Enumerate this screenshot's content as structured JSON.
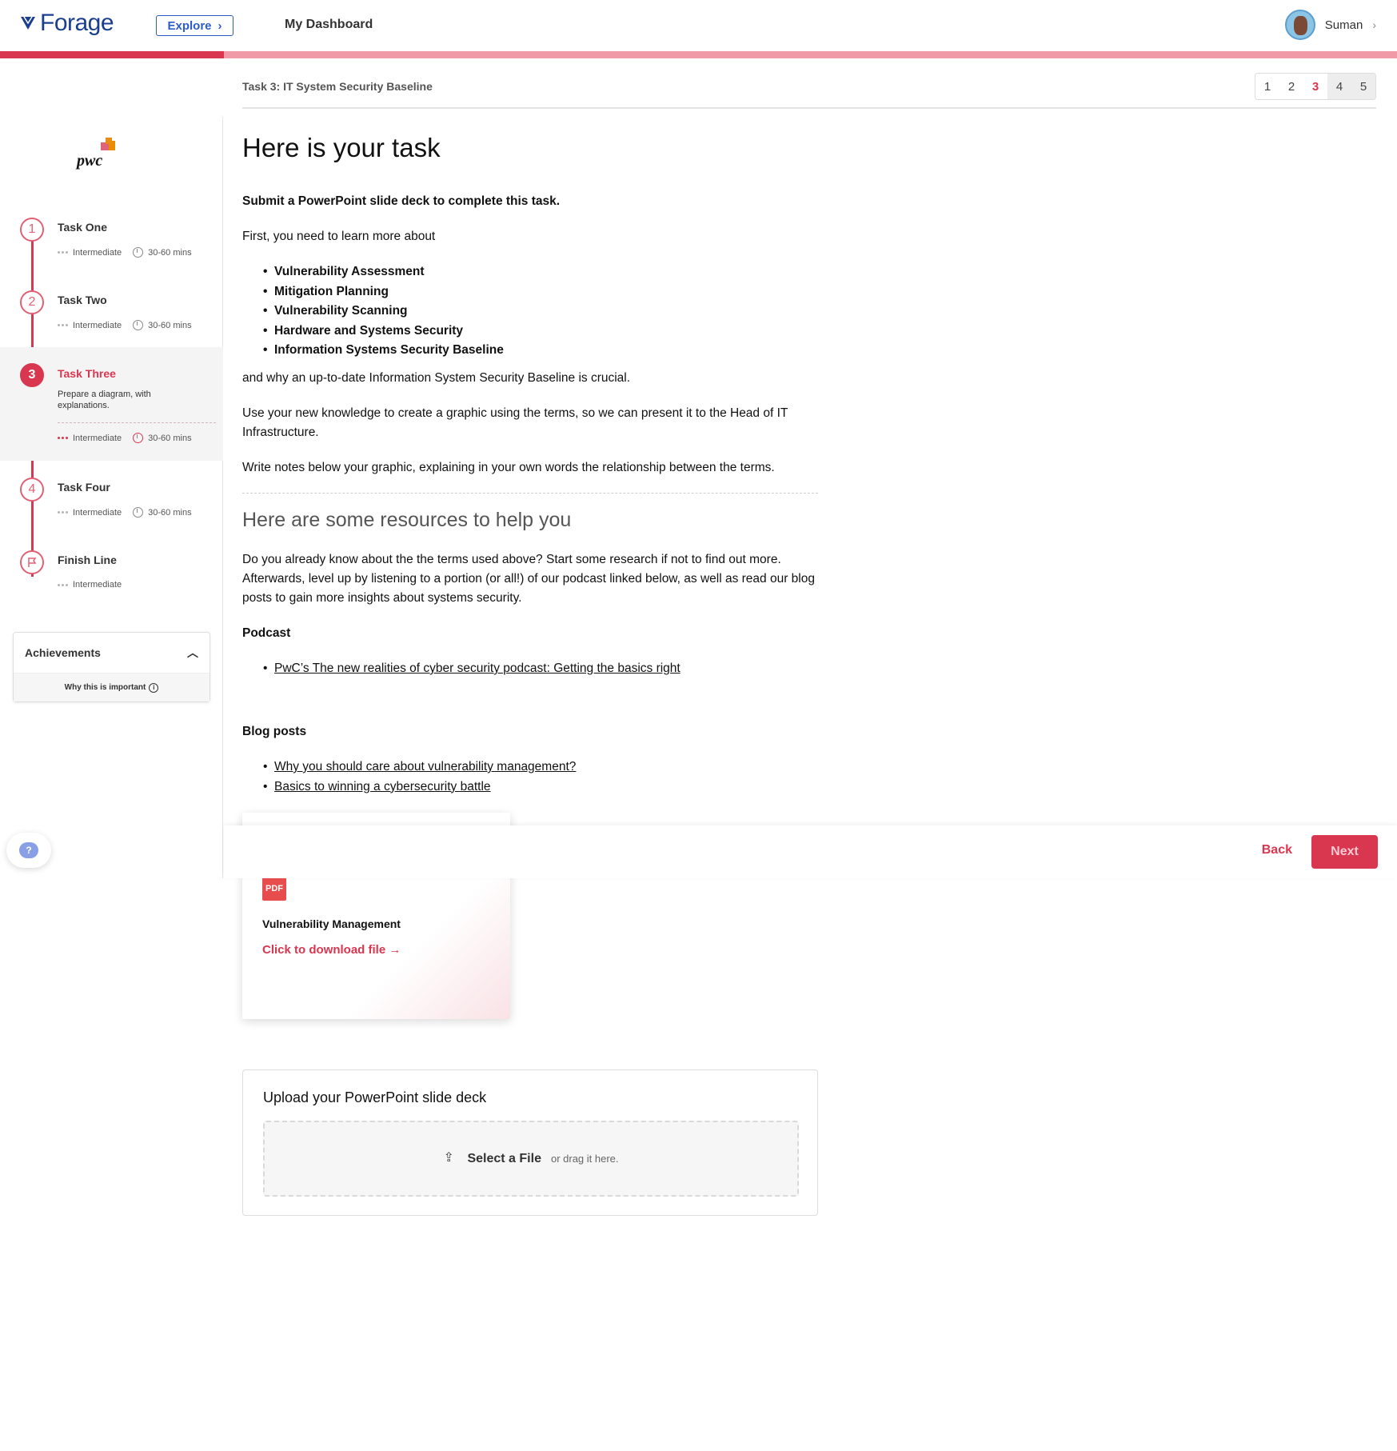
{
  "header": {
    "brand": "Forage",
    "explore_label": "Explore",
    "dashboard_label": "My Dashboard",
    "user_name": "Suman",
    "progress_fraction": 0.16
  },
  "task_header": {
    "label": "Task 3: IT System Security Baseline",
    "pages": [
      "1",
      "2",
      "3",
      "4",
      "5"
    ],
    "current_page": "3"
  },
  "sidebar": {
    "company": "pwc",
    "steps": [
      {
        "number": "1",
        "title": "Task One",
        "level": "Intermediate",
        "duration": "30-60 mins"
      },
      {
        "number": "2",
        "title": "Task Two",
        "level": "Intermediate",
        "duration": "30-60 mins"
      },
      {
        "number": "3",
        "title": "Task Three",
        "description": "Prepare a diagram, with explanations.",
        "level": "Intermediate",
        "duration": "30-60 mins"
      },
      {
        "number": "4",
        "title": "Task Four",
        "level": "Intermediate",
        "duration": "30-60 mins"
      },
      {
        "title": "Finish Line",
        "level": "Intermediate"
      }
    ],
    "achievements": {
      "title": "Achievements",
      "footer": "Why this is important"
    }
  },
  "content": {
    "heading": "Here is your task",
    "intro_bold": "Submit a PowerPoint slide deck to complete this task.",
    "learn_intro": "First, you need to learn more about",
    "topics": [
      "Vulnerability Assessment",
      "Mitigation Planning",
      "Vulnerability Scanning",
      "Hardware and Systems Security",
      "Information Systems Security Baseline"
    ],
    "why": "and why an up-to-date Information System Security Baseline is crucial.",
    "instruction": "Use your new knowledge to create a graphic using the terms, so we can present it to the Head of IT Infrastructure.",
    "notes": "Write notes below your graphic, explaining in your own words the relationship between the terms.",
    "resources_heading": "Here are some resources to help you",
    "resources_intro": "Do you already know about the the terms used above? Start some research if not to find out more. Afterwards, level up by listening to a portion (or all!) of our podcast linked below, as well as read our blog posts to gain more insights about systems security.",
    "podcast_heading": "Podcast",
    "podcast_links": [
      "PwC’s The new realities of cyber security podcast: Getting the basics right"
    ],
    "blog_heading": "Blog posts",
    "blog_links": [
      "Why you should care about vulnerability management?",
      "Basics to winning a cybersecurity battle"
    ]
  },
  "resource_card": {
    "file_type": "PDF",
    "title": "Vulnerability Management",
    "link": "Click to download file →"
  },
  "actions": {
    "back": "Back",
    "next": "Next"
  },
  "upload": {
    "title": "Upload your PowerPoint slide deck",
    "select": "Select a File",
    "drag": "or drag it here."
  },
  "help": {
    "icon": "?"
  }
}
